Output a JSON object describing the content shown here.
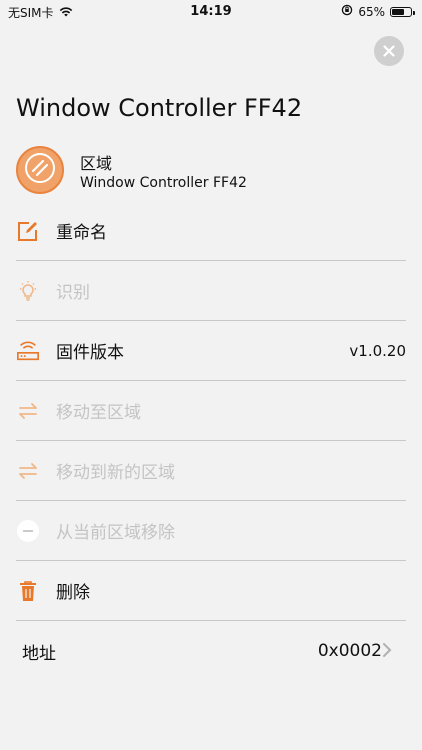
{
  "status_bar": {
    "carrier": "无SIM卡",
    "time": "14:19",
    "battery": "65%",
    "battery_level": 0.65
  },
  "close_icon": "close-icon",
  "title": "Window Controller FF42",
  "zone": {
    "label": "区域",
    "device_name": "Window Controller FF42"
  },
  "menu": {
    "rename": "重命名",
    "identify": "识别",
    "firmware": "固件版本",
    "firmware_version": "v1.0.20",
    "move_to_zone": "移动至区域",
    "move_to_new_zone": "移动到新的区域",
    "remove_from_zone": "从当前区域移除",
    "delete": "删除",
    "address_label": "地址",
    "address_value": "0x0002"
  },
  "colors": {
    "accent": "#e8792b",
    "disabled": "#c4c4c4",
    "background": "#f2f2f2"
  }
}
